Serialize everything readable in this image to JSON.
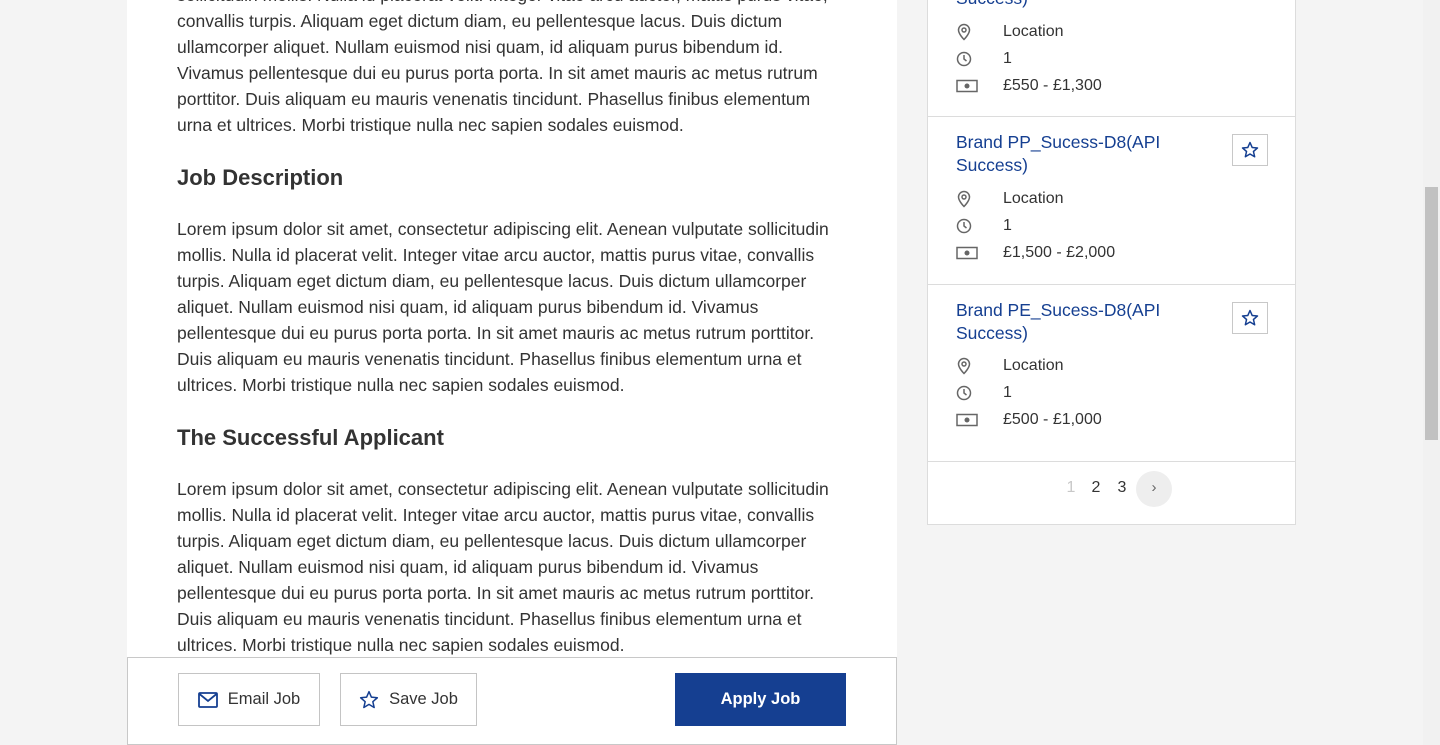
{
  "intro_paragraph": "sollicitudin mollis. Nulla id placerat velit. Integer vitae arcu auctor, mattis purus vitae, convallis turpis. Aliquam eget dictum diam, eu pellentesque lacus. Duis dictum ullamcorper aliquet. Nullam euismod nisi quam, id aliquam purus bibendum id. Vivamus pellentesque dui eu purus porta porta. In sit amet mauris ac metus rutrum porttitor. Duis aliquam eu mauris venenatis tincidunt. Phasellus finibus elementum urna et ultrices. Morbi tristique nulla nec sapien sodales euismod.",
  "sections": [
    {
      "heading": "Job Description",
      "text": "Lorem ipsum dolor sit amet, consectetur adipiscing elit. Aenean vulputate sollicitudin mollis. Nulla id placerat velit. Integer vitae arcu auctor, mattis purus vitae, convallis turpis. Aliquam eget dictum diam, eu pellentesque lacus. Duis dictum ullamcorper aliquet. Nullam euismod nisi quam, id aliquam purus bibendum id. Vivamus pellentesque dui eu purus porta porta. In sit amet mauris ac metus rutrum porttitor. Duis aliquam eu mauris venenatis tincidunt. Phasellus finibus elementum urna et ultrices. Morbi tristique nulla nec sapien sodales euismod."
    },
    {
      "heading": "The Successful Applicant",
      "text": "Lorem ipsum dolor sit amet, consectetur adipiscing elit. Aenean vulputate sollicitudin mollis. Nulla id placerat velit. Integer vitae arcu auctor, mattis purus vitae, convallis turpis. Aliquam eget dictum diam, eu pellentesque lacus. Duis dictum ullamcorper aliquet. Nullam euismod nisi quam, id aliquam purus bibendum id. Vivamus pellentesque dui eu purus porta porta. In sit amet mauris ac metus rutrum porttitor. Duis aliquam eu mauris venenatis tincidunt. Phasellus finibus elementum urna et ultrices. Morbi tristique nulla nec sapien sodales euismod."
    }
  ],
  "actions": {
    "email_label": "Email Job",
    "save_label": "Save Job",
    "apply_label": "Apply Job"
  },
  "sidebar": {
    "jobs": [
      {
        "title": "Success)",
        "location": "Location",
        "hours": "1",
        "salary": "£550 - £1,300"
      },
      {
        "title": "Brand PP_Sucess-D8(API Success)",
        "location": "Location",
        "hours": "1",
        "salary": "£1,500 - £2,000"
      },
      {
        "title": "Brand PE_Sucess-D8(API Success)",
        "location": "Location",
        "hours": "1",
        "salary": "£500 - £1,000"
      }
    ],
    "pagination": {
      "pages": [
        "1",
        "2",
        "3"
      ],
      "next": "›"
    }
  },
  "colors": {
    "brand": "#153f91",
    "background": "#f4f4f4"
  },
  "icons": {
    "email": "envelope-icon",
    "save": "star-icon",
    "location": "map-pin-icon",
    "hours": "clock-icon",
    "salary": "banknote-icon"
  }
}
